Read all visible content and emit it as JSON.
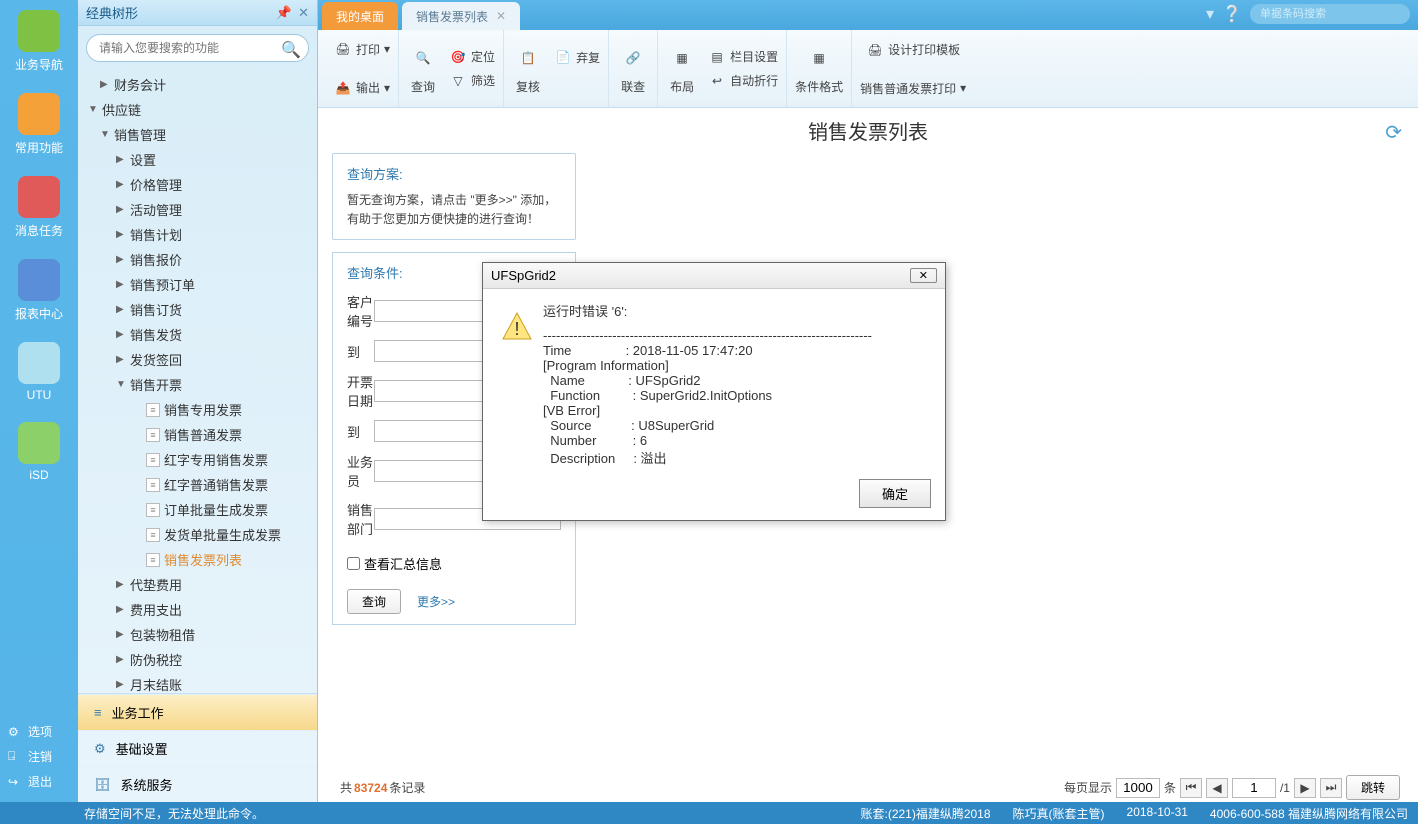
{
  "rail": [
    {
      "label": "业务导航",
      "color": "#7fc243"
    },
    {
      "label": "常用功能",
      "color": "#f5a13a"
    },
    {
      "label": "消息任务",
      "color": "#e15a5a"
    },
    {
      "label": "报表中心",
      "color": "#5a8ed8"
    },
    {
      "label": "UTU",
      "color": "#aee0f0"
    },
    {
      "label": "iSD",
      "color": "#8cd06a"
    }
  ],
  "railBottom": [
    "选项",
    "注销",
    "退出"
  ],
  "sidebar": {
    "title": "经典树形",
    "searchPlaceholder": "请输入您要搜索的功能",
    "nodes": [
      {
        "t": "财务会计",
        "i": 1,
        "c": "▶"
      },
      {
        "t": "供应链",
        "i": 0,
        "c": "▼"
      },
      {
        "t": "销售管理",
        "i": 1,
        "c": "▼"
      },
      {
        "t": "设置",
        "i": 2,
        "c": "▶"
      },
      {
        "t": "价格管理",
        "i": 2,
        "c": "▶"
      },
      {
        "t": "活动管理",
        "i": 2,
        "c": "▶"
      },
      {
        "t": "销售计划",
        "i": 2,
        "c": "▶"
      },
      {
        "t": "销售报价",
        "i": 2,
        "c": "▶"
      },
      {
        "t": "销售预订单",
        "i": 2,
        "c": "▶"
      },
      {
        "t": "销售订货",
        "i": 2,
        "c": "▶"
      },
      {
        "t": "销售发货",
        "i": 2,
        "c": "▶"
      },
      {
        "t": "发货签回",
        "i": 2,
        "c": "▶"
      },
      {
        "t": "销售开票",
        "i": 2,
        "c": "▼"
      },
      {
        "t": "销售专用发票",
        "i": 3,
        "leaf": true
      },
      {
        "t": "销售普通发票",
        "i": 3,
        "leaf": true
      },
      {
        "t": "红字专用销售发票",
        "i": 3,
        "leaf": true
      },
      {
        "t": "红字普通销售发票",
        "i": 3,
        "leaf": true
      },
      {
        "t": "订单批量生成发票",
        "i": 3,
        "leaf": true
      },
      {
        "t": "发货单批量生成发票",
        "i": 3,
        "leaf": true
      },
      {
        "t": "销售发票列表",
        "i": 3,
        "leaf": true,
        "active": true
      },
      {
        "t": "代垫费用",
        "i": 2,
        "c": "▶"
      },
      {
        "t": "费用支出",
        "i": 2,
        "c": "▶"
      },
      {
        "t": "包装物租借",
        "i": 2,
        "c": "▶"
      },
      {
        "t": "防伪税控",
        "i": 2,
        "c": "▶"
      },
      {
        "t": "月末结账",
        "i": 2,
        "c": "▶"
      }
    ],
    "bottom": [
      "业务工作",
      "基础设置",
      "系统服务"
    ]
  },
  "tabs": [
    {
      "label": "我的桌面",
      "active": false
    },
    {
      "label": "销售发票列表",
      "active": true
    }
  ],
  "topSearchPlaceholder": "单据条码搜索",
  "ribbon": {
    "g1": {
      "print": "打印",
      "output": "输出"
    },
    "g2": {
      "query": "查询",
      "locate": "定位",
      "filter": "筛选"
    },
    "g3": {
      "review": "复核",
      "abandon": "弃复"
    },
    "g4": {
      "joint": "联查"
    },
    "g5": {
      "layout": "布局",
      "cols": "栏目设置",
      "wrap": "自动折行"
    },
    "g6": {
      "cond": "条件格式"
    },
    "g7": {
      "tpl": "设计打印模板",
      "prt": "销售普通发票打印"
    }
  },
  "pageTitle": "销售发票列表",
  "queryPlan": {
    "title": "查询方案:",
    "body": "暂无查询方案，请点击 \"更多>>\" 添加，有助于您更加方便快捷的进行查询！"
  },
  "queryCond": {
    "title": "查询条件:",
    "fields": [
      "客户编号",
      "到",
      "开票日期",
      "到",
      "业务员",
      "销售部门"
    ],
    "chk": "查看汇总信息",
    "btn": "查询",
    "more": "更多>>"
  },
  "records": {
    "prefix": "共",
    "count": "83724",
    "suffix": "条记录",
    "perLabel": "每页显示",
    "per": "1000",
    "unit": "条",
    "page": "1",
    "total": "/1",
    "jump": "跳转"
  },
  "dialog": {
    "title": "UFSpGrid2",
    "err": "运行时错误 '6':",
    "lines": [
      "----------------------------------------------------------------------------",
      "Time               : 2018-11-05 17:47:20",
      "[Program Information]",
      "  Name            : UFSpGrid2",
      "  Function         : SuperGrid2.InitOptions",
      "[VB Error]",
      "  Source           : U8SuperGrid",
      "  Number          : 6",
      "  Description     : 溢出"
    ],
    "ok": "确定"
  },
  "status": {
    "left": "存储空间不足，无法处理此命令。",
    "r1": "账套:(221)福建纵腾2018",
    "r2": "陈巧真(账套主管)",
    "r3": "2018-10-31",
    "r4": "4006-600-588 福建纵腾网络有限公司"
  }
}
